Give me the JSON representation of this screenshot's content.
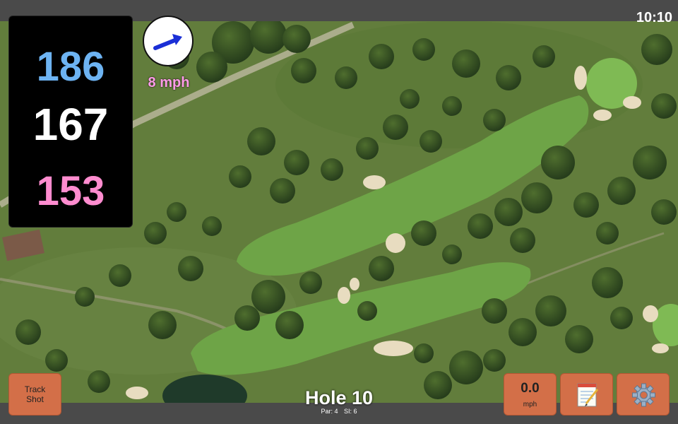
{
  "status": {
    "time": "10:10"
  },
  "distances": {
    "back": "186",
    "middle": "167",
    "front": "153"
  },
  "wind": {
    "speed_label": "8 mph",
    "direction_icon": "wind-arrow-icon"
  },
  "buttons": {
    "track_shot_line1": "Track",
    "track_shot_line2": "Shot",
    "wind_value": "0.0",
    "wind_unit": "mph",
    "notes_icon": "notepad-icon",
    "settings_icon": "gear-icon"
  },
  "hole": {
    "title": "Hole 10",
    "par": "Par: 4",
    "si": "SI: 6"
  },
  "colors": {
    "back_distance": "#6db3f2",
    "middle_distance": "#ffffff",
    "front_distance": "#ff8ccf",
    "button": "#d36f48",
    "wind_arrow": "#1a2fd6"
  }
}
